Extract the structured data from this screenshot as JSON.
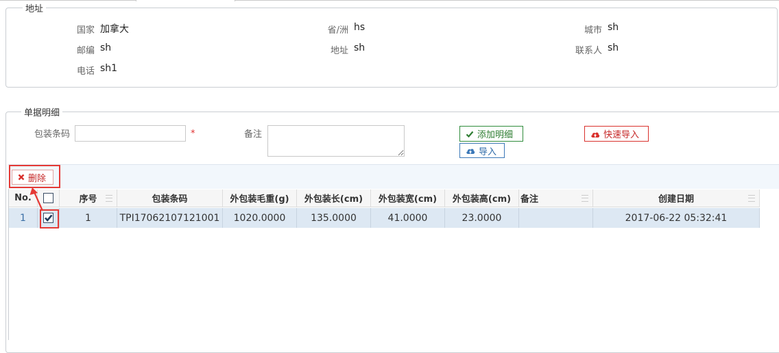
{
  "address": {
    "legend": "地址",
    "fields": {
      "country": {
        "label": "国家",
        "value": "加拿大"
      },
      "province": {
        "label": "省/洲",
        "value": "hs"
      },
      "city": {
        "label": "城市",
        "value": "sh"
      },
      "postcode": {
        "label": "邮编",
        "value": "sh"
      },
      "address": {
        "label": "地址",
        "value": "sh"
      },
      "contact": {
        "label": "联系人",
        "value": "sh"
      },
      "phone": {
        "label": "电话",
        "value": "sh1"
      }
    }
  },
  "detail": {
    "legend": "单据明细",
    "barcode_label": "包装条码",
    "barcode_value": "",
    "required_mark": "*",
    "remark_label": "备注",
    "remark_value": "",
    "add_button": "添加明细",
    "import_button": "导入",
    "quick_import_button": "快速导入",
    "delete_button": "删除"
  },
  "table": {
    "headers": {
      "no": "No.",
      "seq": "序号",
      "barcode": "包装条码",
      "weight": "外包装毛重(g)",
      "length": "外包装长(cm)",
      "width": "外包装宽(cm)",
      "height": "外包装高(cm)",
      "remark": "备注",
      "created": "创建日期"
    },
    "rows": [
      {
        "no": "1",
        "checked": true,
        "seq": "1",
        "barcode": "TPI17062107121001",
        "weight": "1020.0000",
        "length": "135.0000",
        "width": "41.0000",
        "height": "23.0000",
        "remark": "",
        "created": "2017-06-22 05:32:41"
      }
    ]
  },
  "colors": {
    "highlight": "#e53935",
    "row_selected": "#dde8f3",
    "btn_green": "#2e7d32",
    "btn_blue": "#2d6aa8",
    "btn_red": "#c62828"
  }
}
